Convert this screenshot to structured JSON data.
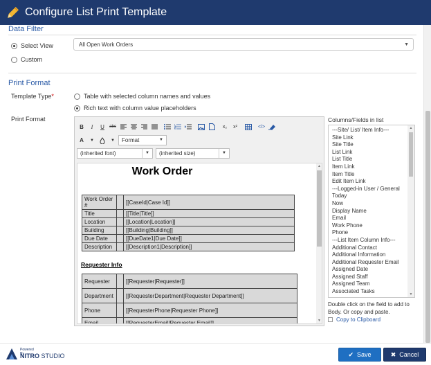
{
  "window": {
    "title": "Configure List Print Template"
  },
  "data_filter": {
    "section_title": "Data Filter",
    "options": [
      {
        "label": "Select View",
        "checked": true
      },
      {
        "label": "Custom",
        "checked": false
      }
    ],
    "view_value": "All Open Work Orders"
  },
  "print_format": {
    "section_title": "Print Format",
    "template_type_label": "Template Type",
    "template_options": [
      {
        "label": "Table with selected column names and values",
        "checked": false
      },
      {
        "label": "Rich text with column value placeholders",
        "checked": true
      }
    ],
    "print_format_label": "Print Format"
  },
  "editor": {
    "toolbar": {
      "format_dd": "Format",
      "font_dd": "(inherited font)",
      "size_dd": "(inherited size)",
      "bold": "B",
      "italic": "I",
      "underline": "U",
      "strike": "abc",
      "text_color": "A",
      "subscript": "x₂",
      "superscript": "x²"
    },
    "doc": {
      "heading": "Work Order",
      "table1": [
        [
          "Work Order #",
          "[[CaseId|Case Id]]"
        ],
        [
          "Title",
          "[[Title|Title]]"
        ],
        [
          "Location",
          "[[Location|Location]]"
        ],
        [
          "Building",
          "[[Building|Building]]"
        ],
        [
          "Due Date",
          "[[DueDate1|Due Date]]"
        ],
        [
          "Description",
          "[[Description1|Description]]"
        ]
      ],
      "sub_heading": "Requester Info",
      "table2": [
        [
          "Requester",
          "[[Requester|Requester]]"
        ],
        [
          "Department",
          "[[RequesterDepartment|Requester Department]]"
        ],
        [
          "Phone",
          "[[RequesterPhone|Requester Phone]]"
        ],
        [
          "Email",
          "[[RequesterEmail|Requester Email]]"
        ]
      ]
    }
  },
  "fields": {
    "label": "Columns/Fields in list",
    "items": [
      "---Site/ List/ Item Info---",
      "Site Link",
      "Site Title",
      "List Link",
      "List Title",
      "Item Link",
      "Item Title",
      "Edit Item Link",
      "---Logged-in User / General",
      "Today",
      "Now",
      "Display Name",
      "Email",
      "Work Phone",
      "Phone",
      "---List Item Column Info---",
      "Additional Contact",
      "Additional Information",
      "Additional Requester Email",
      "Assigned Date",
      "Assigned Staff",
      "Assigned Team",
      "Associated Tasks"
    ],
    "help_text": "Double click on the field to add to Body. Or copy and paste.",
    "copy_link": "Copy to Clipboard"
  },
  "footer": {
    "powered_by": "Powered By",
    "brand_bold": "NITRO",
    "brand_rest": "STUDIO",
    "save_label": "Save",
    "cancel_label": "Cancel"
  },
  "colors": {
    "titlebar": "#1f3a6e",
    "accent": "#2a5aa6",
    "save_button": "#1f6fc2",
    "cancel_button": "#1f3a6e"
  }
}
